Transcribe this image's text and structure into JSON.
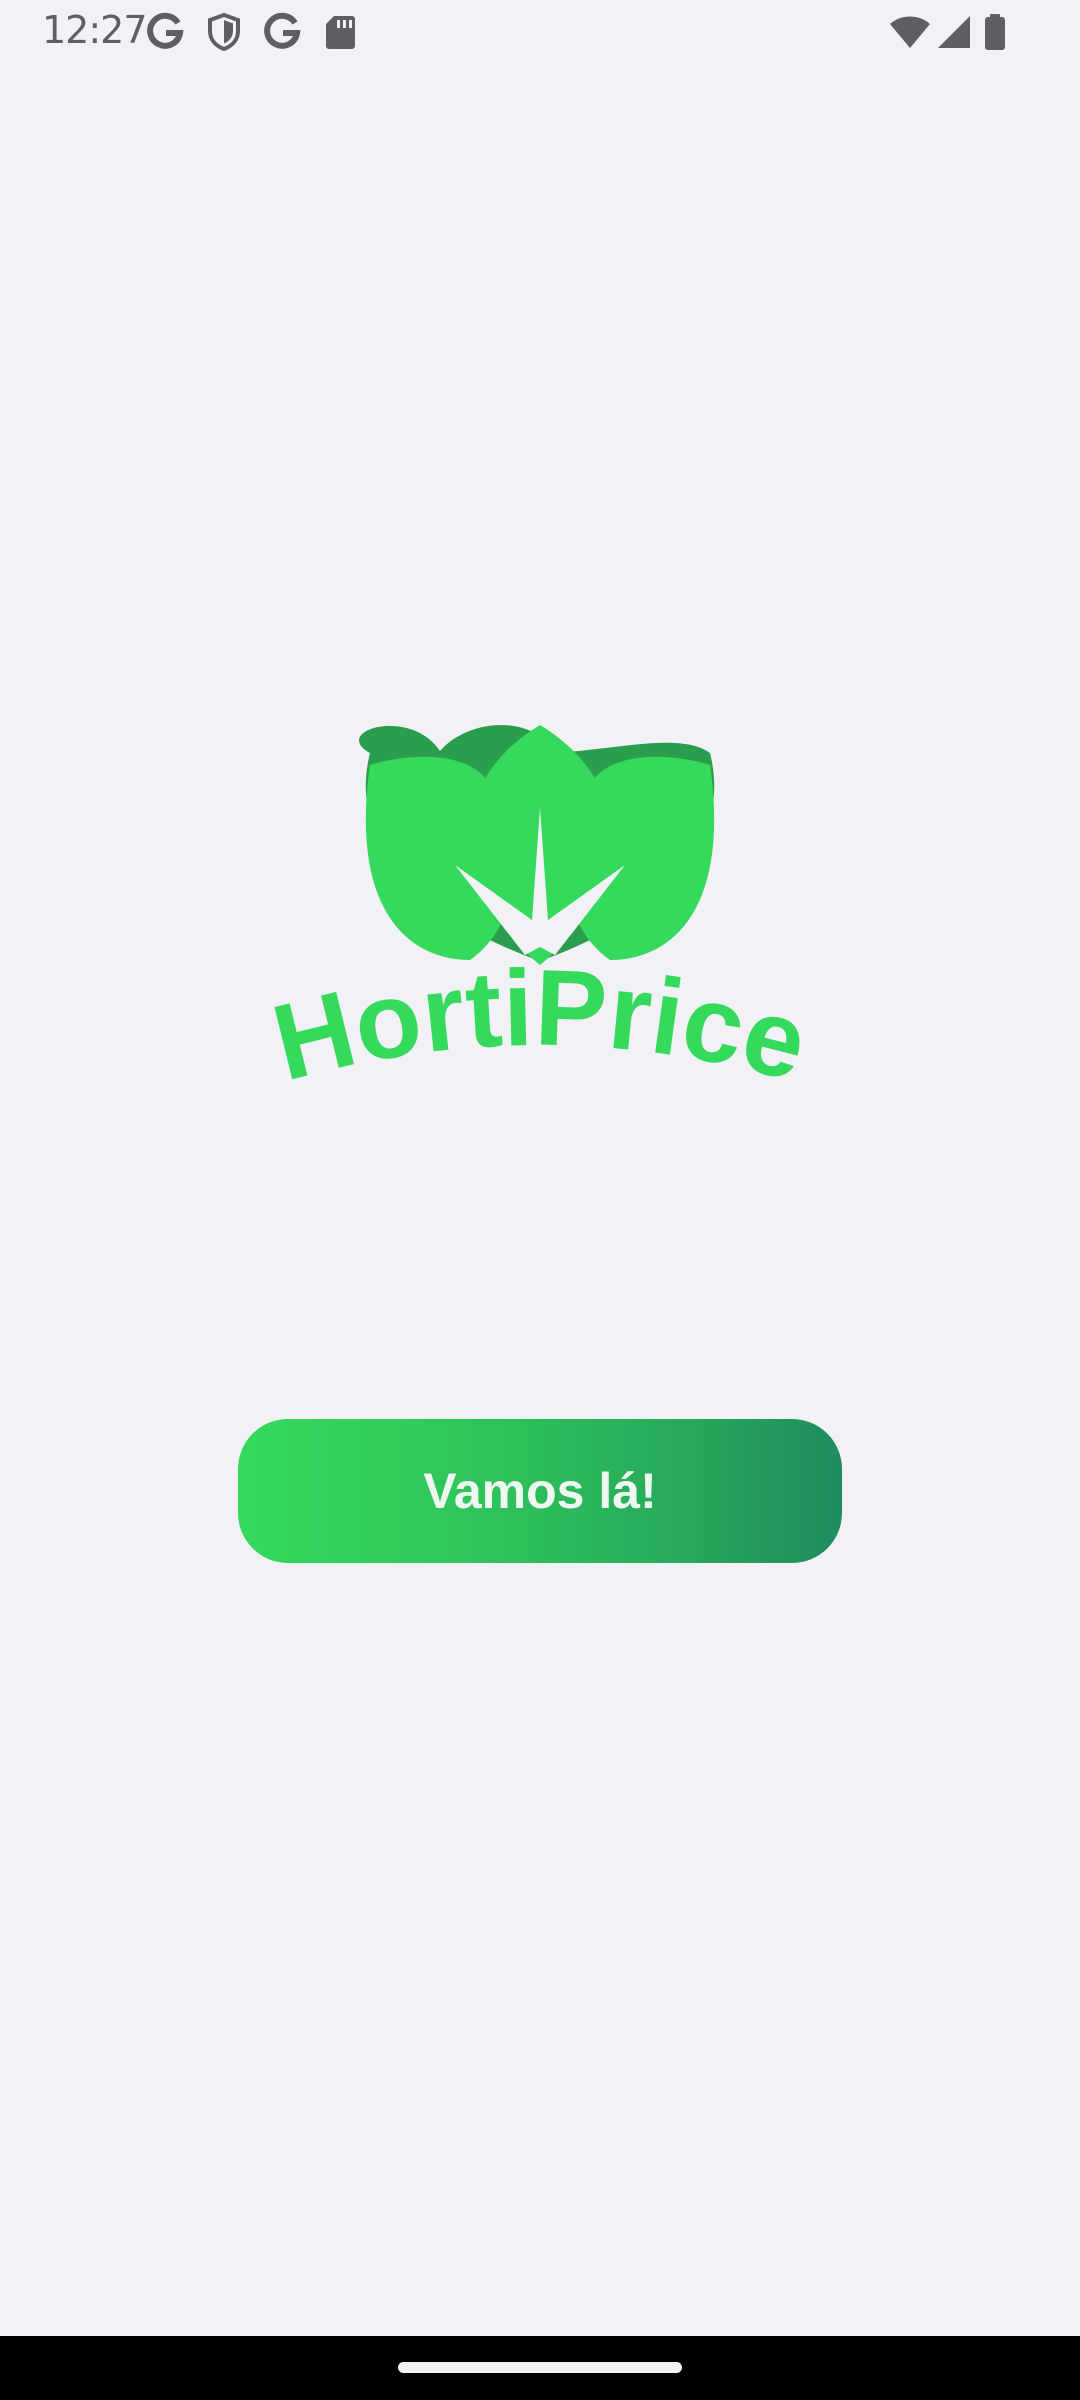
{
  "status_bar": {
    "time": "12:27",
    "left_icons": [
      "google-icon",
      "vpn-shield-icon",
      "google-icon",
      "sd-card-icon"
    ],
    "right_icons": [
      "wifi-icon",
      "cell-signal-icon",
      "battery-icon"
    ]
  },
  "logo": {
    "text": "HortiPrice",
    "icon": "leaves-icon",
    "color": "#35d95c",
    "shadow_color": "#2a9e4c"
  },
  "start_button": {
    "label": "Vamos lá!",
    "gradient_start": "#35d95c",
    "gradient_end": "#208c5e"
  },
  "nav_bar": {
    "home_handle": "home-gesture-handle"
  }
}
